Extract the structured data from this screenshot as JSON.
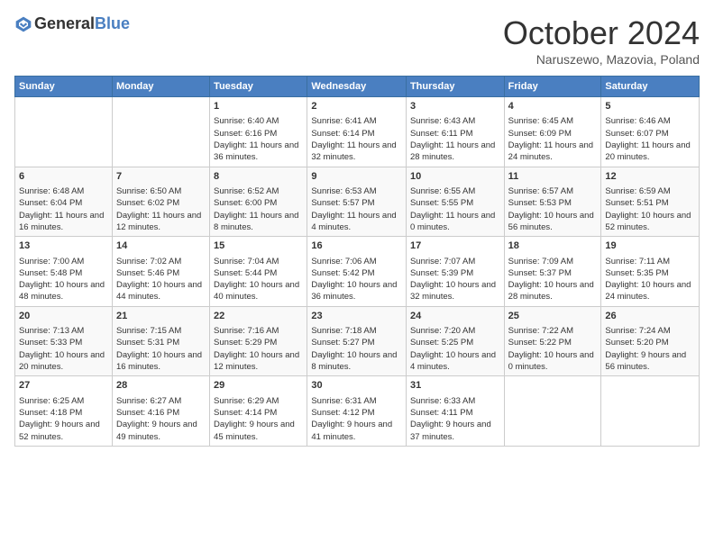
{
  "header": {
    "logo_line1": "General",
    "logo_line2": "Blue",
    "month": "October 2024",
    "location": "Naruszewo, Mazovia, Poland"
  },
  "days_of_week": [
    "Sunday",
    "Monday",
    "Tuesday",
    "Wednesday",
    "Thursday",
    "Friday",
    "Saturday"
  ],
  "weeks": [
    [
      {
        "day": "",
        "sunrise": "",
        "sunset": "",
        "daylight": ""
      },
      {
        "day": "",
        "sunrise": "",
        "sunset": "",
        "daylight": ""
      },
      {
        "day": "1",
        "sunrise": "Sunrise: 6:40 AM",
        "sunset": "Sunset: 6:16 PM",
        "daylight": "Daylight: 11 hours and 36 minutes."
      },
      {
        "day": "2",
        "sunrise": "Sunrise: 6:41 AM",
        "sunset": "Sunset: 6:14 PM",
        "daylight": "Daylight: 11 hours and 32 minutes."
      },
      {
        "day": "3",
        "sunrise": "Sunrise: 6:43 AM",
        "sunset": "Sunset: 6:11 PM",
        "daylight": "Daylight: 11 hours and 28 minutes."
      },
      {
        "day": "4",
        "sunrise": "Sunrise: 6:45 AM",
        "sunset": "Sunset: 6:09 PM",
        "daylight": "Daylight: 11 hours and 24 minutes."
      },
      {
        "day": "5",
        "sunrise": "Sunrise: 6:46 AM",
        "sunset": "Sunset: 6:07 PM",
        "daylight": "Daylight: 11 hours and 20 minutes."
      }
    ],
    [
      {
        "day": "6",
        "sunrise": "Sunrise: 6:48 AM",
        "sunset": "Sunset: 6:04 PM",
        "daylight": "Daylight: 11 hours and 16 minutes."
      },
      {
        "day": "7",
        "sunrise": "Sunrise: 6:50 AM",
        "sunset": "Sunset: 6:02 PM",
        "daylight": "Daylight: 11 hours and 12 minutes."
      },
      {
        "day": "8",
        "sunrise": "Sunrise: 6:52 AM",
        "sunset": "Sunset: 6:00 PM",
        "daylight": "Daylight: 11 hours and 8 minutes."
      },
      {
        "day": "9",
        "sunrise": "Sunrise: 6:53 AM",
        "sunset": "Sunset: 5:57 PM",
        "daylight": "Daylight: 11 hours and 4 minutes."
      },
      {
        "day": "10",
        "sunrise": "Sunrise: 6:55 AM",
        "sunset": "Sunset: 5:55 PM",
        "daylight": "Daylight: 11 hours and 0 minutes."
      },
      {
        "day": "11",
        "sunrise": "Sunrise: 6:57 AM",
        "sunset": "Sunset: 5:53 PM",
        "daylight": "Daylight: 10 hours and 56 minutes."
      },
      {
        "day": "12",
        "sunrise": "Sunrise: 6:59 AM",
        "sunset": "Sunset: 5:51 PM",
        "daylight": "Daylight: 10 hours and 52 minutes."
      }
    ],
    [
      {
        "day": "13",
        "sunrise": "Sunrise: 7:00 AM",
        "sunset": "Sunset: 5:48 PM",
        "daylight": "Daylight: 10 hours and 48 minutes."
      },
      {
        "day": "14",
        "sunrise": "Sunrise: 7:02 AM",
        "sunset": "Sunset: 5:46 PM",
        "daylight": "Daylight: 10 hours and 44 minutes."
      },
      {
        "day": "15",
        "sunrise": "Sunrise: 7:04 AM",
        "sunset": "Sunset: 5:44 PM",
        "daylight": "Daylight: 10 hours and 40 minutes."
      },
      {
        "day": "16",
        "sunrise": "Sunrise: 7:06 AM",
        "sunset": "Sunset: 5:42 PM",
        "daylight": "Daylight: 10 hours and 36 minutes."
      },
      {
        "day": "17",
        "sunrise": "Sunrise: 7:07 AM",
        "sunset": "Sunset: 5:39 PM",
        "daylight": "Daylight: 10 hours and 32 minutes."
      },
      {
        "day": "18",
        "sunrise": "Sunrise: 7:09 AM",
        "sunset": "Sunset: 5:37 PM",
        "daylight": "Daylight: 10 hours and 28 minutes."
      },
      {
        "day": "19",
        "sunrise": "Sunrise: 7:11 AM",
        "sunset": "Sunset: 5:35 PM",
        "daylight": "Daylight: 10 hours and 24 minutes."
      }
    ],
    [
      {
        "day": "20",
        "sunrise": "Sunrise: 7:13 AM",
        "sunset": "Sunset: 5:33 PM",
        "daylight": "Daylight: 10 hours and 20 minutes."
      },
      {
        "day": "21",
        "sunrise": "Sunrise: 7:15 AM",
        "sunset": "Sunset: 5:31 PM",
        "daylight": "Daylight: 10 hours and 16 minutes."
      },
      {
        "day": "22",
        "sunrise": "Sunrise: 7:16 AM",
        "sunset": "Sunset: 5:29 PM",
        "daylight": "Daylight: 10 hours and 12 minutes."
      },
      {
        "day": "23",
        "sunrise": "Sunrise: 7:18 AM",
        "sunset": "Sunset: 5:27 PM",
        "daylight": "Daylight: 10 hours and 8 minutes."
      },
      {
        "day": "24",
        "sunrise": "Sunrise: 7:20 AM",
        "sunset": "Sunset: 5:25 PM",
        "daylight": "Daylight: 10 hours and 4 minutes."
      },
      {
        "day": "25",
        "sunrise": "Sunrise: 7:22 AM",
        "sunset": "Sunset: 5:22 PM",
        "daylight": "Daylight: 10 hours and 0 minutes."
      },
      {
        "day": "26",
        "sunrise": "Sunrise: 7:24 AM",
        "sunset": "Sunset: 5:20 PM",
        "daylight": "Daylight: 9 hours and 56 minutes."
      }
    ],
    [
      {
        "day": "27",
        "sunrise": "Sunrise: 6:25 AM",
        "sunset": "Sunset: 4:18 PM",
        "daylight": "Daylight: 9 hours and 52 minutes."
      },
      {
        "day": "28",
        "sunrise": "Sunrise: 6:27 AM",
        "sunset": "Sunset: 4:16 PM",
        "daylight": "Daylight: 9 hours and 49 minutes."
      },
      {
        "day": "29",
        "sunrise": "Sunrise: 6:29 AM",
        "sunset": "Sunset: 4:14 PM",
        "daylight": "Daylight: 9 hours and 45 minutes."
      },
      {
        "day": "30",
        "sunrise": "Sunrise: 6:31 AM",
        "sunset": "Sunset: 4:12 PM",
        "daylight": "Daylight: 9 hours and 41 minutes."
      },
      {
        "day": "31",
        "sunrise": "Sunrise: 6:33 AM",
        "sunset": "Sunset: 4:11 PM",
        "daylight": "Daylight: 9 hours and 37 minutes."
      },
      {
        "day": "",
        "sunrise": "",
        "sunset": "",
        "daylight": ""
      },
      {
        "day": "",
        "sunrise": "",
        "sunset": "",
        "daylight": ""
      }
    ]
  ]
}
